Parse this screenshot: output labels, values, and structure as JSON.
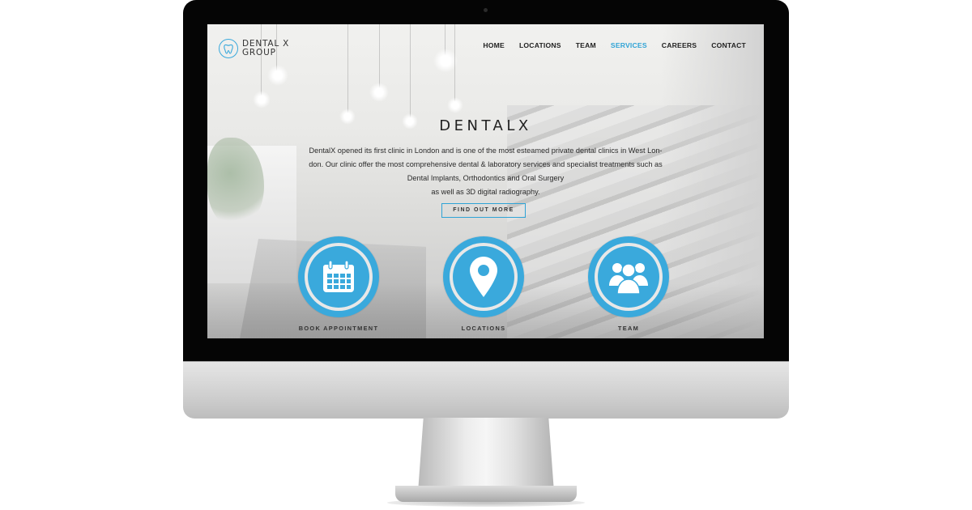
{
  "site": {
    "logo": {
      "line1": "DENTAL X",
      "line2": "GROUP",
      "icon": "tooth-icon"
    },
    "nav": [
      {
        "label": "HOME",
        "active": false
      },
      {
        "label": "LOCATIONS",
        "active": false
      },
      {
        "label": "TEAM",
        "active": false
      },
      {
        "label": "SERVICES",
        "active": true
      },
      {
        "label": "CAREERS",
        "active": false
      },
      {
        "label": "CONTACT",
        "active": false
      }
    ],
    "hero": {
      "title": "DENTALX",
      "lines": [
        "DentalX opened its first clinic in London  and is one of the most esteamed private dental clinics in West Lon-",
        "don. Our clinic offer the most comprehensive dental & laboratory services and specialist treatments such as",
        "Dental Implants, Orthodontics and Oral Surgery",
        "as well as 3D digital radiography."
      ],
      "cta_label": "FIND OUT MORE"
    },
    "features": [
      {
        "label": "BOOK APPOINTMENT",
        "icon": "calendar-icon"
      },
      {
        "label": "LOCATIONS",
        "icon": "map-pin-icon"
      },
      {
        "label": "TEAM",
        "icon": "team-icon"
      }
    ]
  },
  "colors": {
    "accent": "#3aa9dc",
    "bezel": "#050505",
    "text": "#222222"
  }
}
